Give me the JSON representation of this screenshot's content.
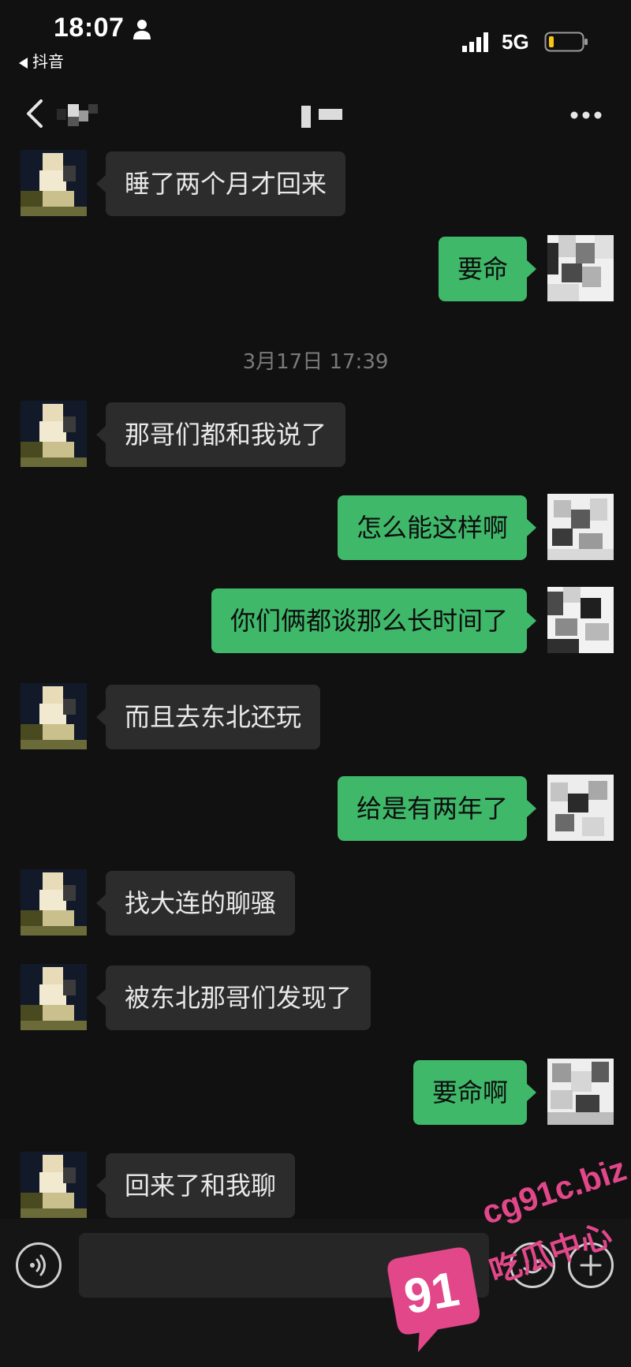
{
  "status_bar": {
    "time": "18:07",
    "back_app": "抖音",
    "network": "5G"
  },
  "nav": {
    "back_icon": "chevron-left-icon",
    "more_icon": "more-horizontal-icon"
  },
  "chat": {
    "timestamp": "3月17日 17:39",
    "messages": [
      {
        "side": "in",
        "text": "睡了两个月才回来"
      },
      {
        "side": "out",
        "text": "要命"
      },
      {
        "side": "in",
        "text": "那哥们都和我说了"
      },
      {
        "side": "out",
        "text": "怎么能这样啊"
      },
      {
        "side": "out",
        "text": "你们俩都谈那么长时间了"
      },
      {
        "side": "in",
        "text": "而且去东北还玩"
      },
      {
        "side": "out",
        "text": "给是有两年了"
      },
      {
        "side": "in",
        "text": "找大连的聊骚"
      },
      {
        "side": "in",
        "text": "被东北那哥们发现了"
      },
      {
        "side": "out",
        "text": "要命啊"
      },
      {
        "side": "in",
        "text": "回来了和我聊"
      }
    ]
  },
  "input_bar": {
    "voice_icon": "voice-icon",
    "emoji_icon": "emoji-icon",
    "plus_icon": "plus-icon"
  },
  "watermark": {
    "url": "cg91c.biz",
    "name": "吃瓜中心",
    "logo_text": "91"
  },
  "colors": {
    "background": "#111111",
    "incoming_bubble": "#2c2c2c",
    "outgoing_bubble": "#3fb86a",
    "timestamp": "#7a7a7a",
    "watermark": "#e2478a"
  }
}
